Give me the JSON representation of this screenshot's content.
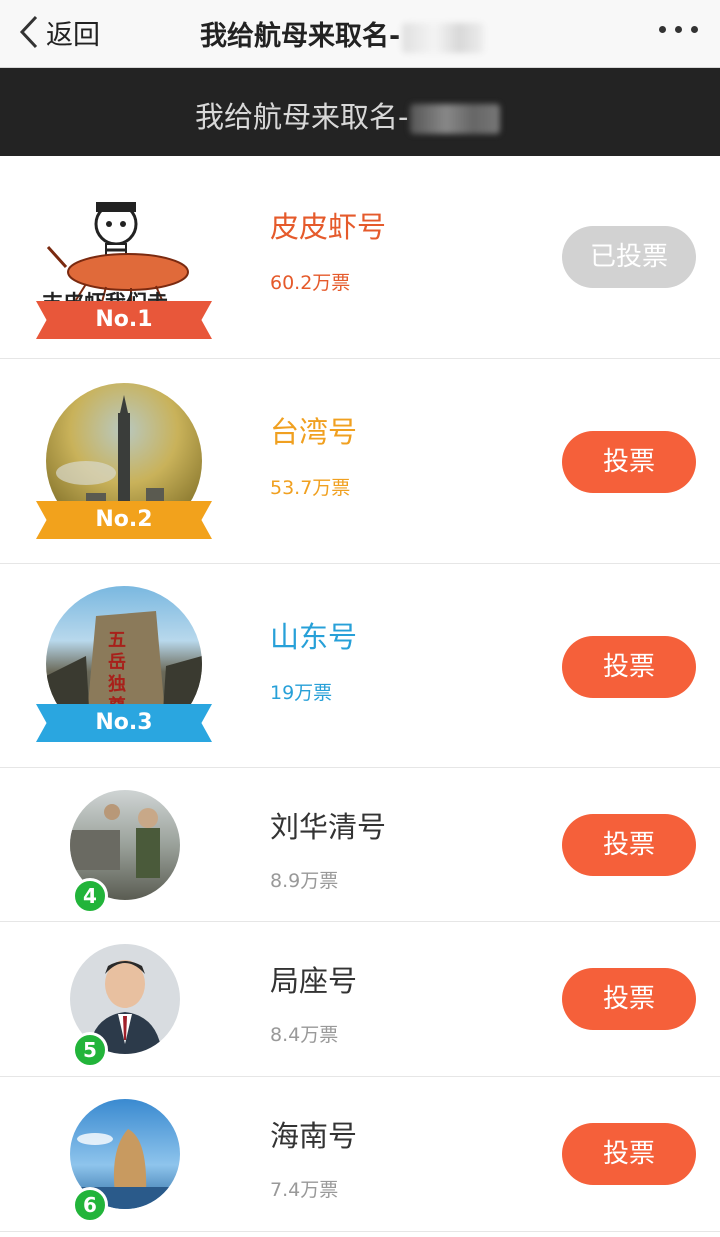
{
  "nav": {
    "back_label": "返回",
    "title": "我给航母来取名-"
  },
  "banner": {
    "title": "我给航母来取名-"
  },
  "colors": {
    "vote_button": "#f5603a",
    "voted_button": "#d2d2d2",
    "rank1": "#e55a2b",
    "rank2": "#f0a020",
    "rank3": "#27a0d8",
    "rank_other": "#333333",
    "votes_other": "#999999",
    "rank_badge": "#22b43a"
  },
  "items": [
    {
      "rank_label": "No.1",
      "name": "皮皮虾号",
      "votes": "60.2万票",
      "button": "已投票"
    },
    {
      "rank_label": "No.2",
      "name": "台湾号",
      "votes": "53.7万票",
      "button": "投票"
    },
    {
      "rank_label": "No.3",
      "name": "山东号",
      "votes": "19万票",
      "button": "投票"
    },
    {
      "rank_label": "4",
      "name": "刘华清号",
      "votes": "8.9万票",
      "button": "投票"
    },
    {
      "rank_label": "5",
      "name": "局座号",
      "votes": "8.4万票",
      "button": "投票"
    },
    {
      "rank_label": "6",
      "name": "海南号",
      "votes": "7.4万票",
      "button": "投票"
    }
  ],
  "icons": [
    "chevron-left-icon",
    "more-dots-icon"
  ]
}
